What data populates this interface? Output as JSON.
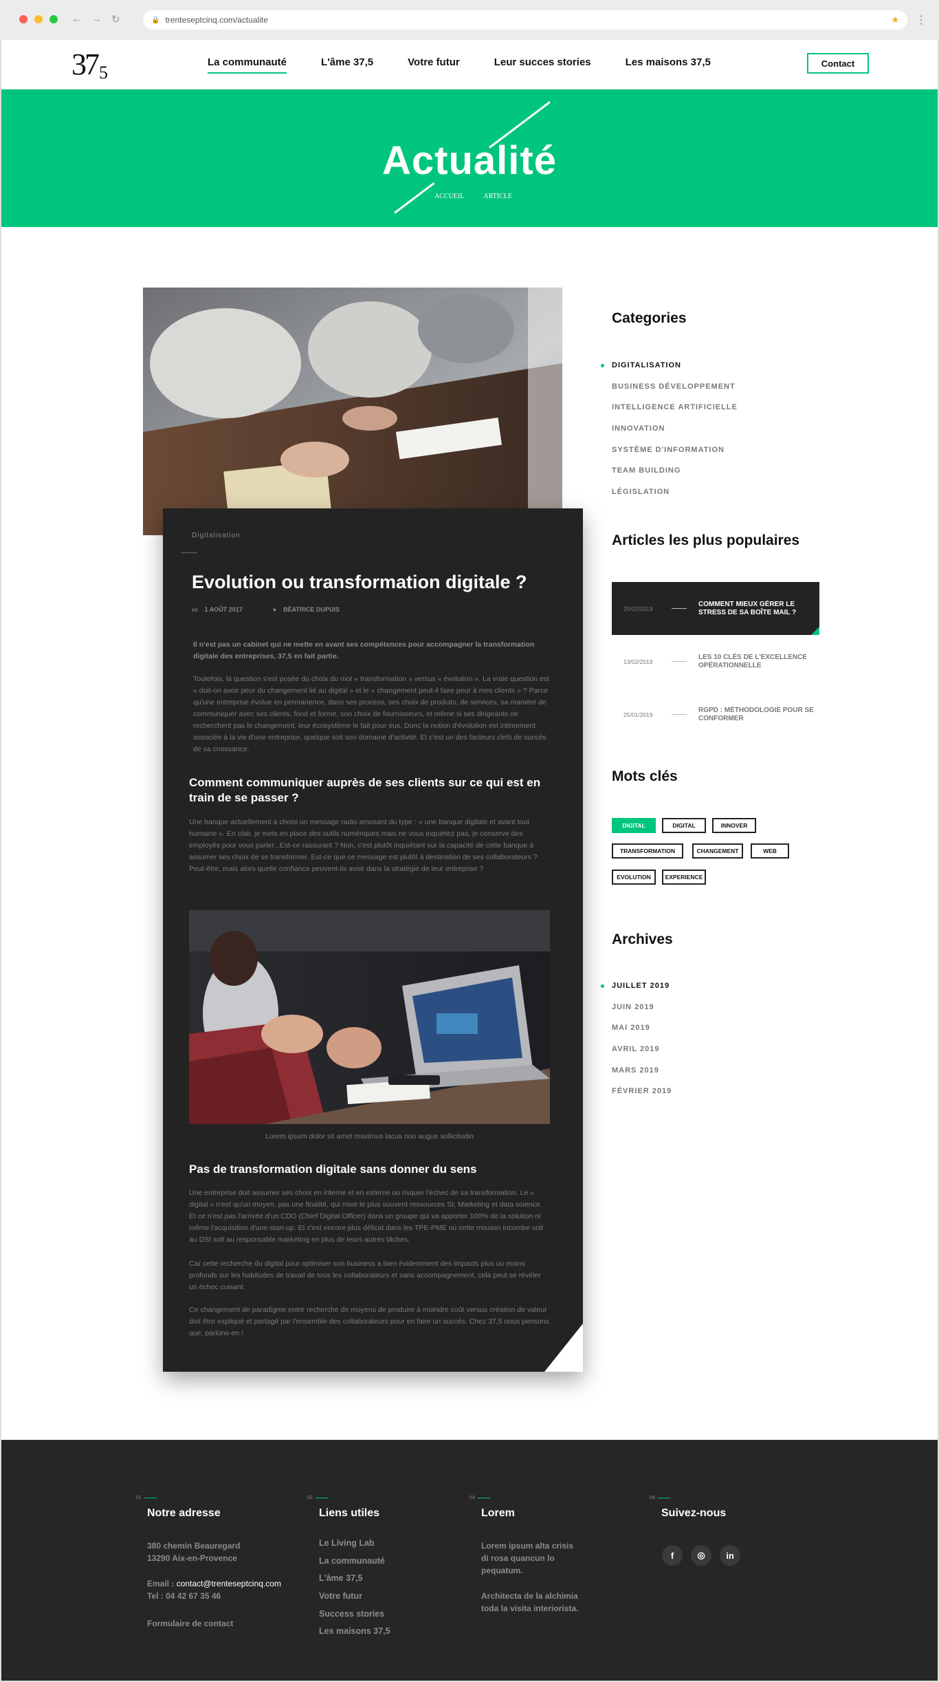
{
  "browser": {
    "url": "trenteseptcinq.com/actualite"
  },
  "header": {
    "logo": "37",
    "logo_sub": "5",
    "nav": [
      {
        "label": "La communauté"
      },
      {
        "label": "L'âme 37,5"
      },
      {
        "label": "Votre futur"
      },
      {
        "label": "Leur succes stories"
      },
      {
        "label": "Les maisons 37,5"
      }
    ],
    "contact": "Contact"
  },
  "hero": {
    "title": "Actualité",
    "crumbs": [
      "ACCUEIL",
      "ARTICLE"
    ]
  },
  "article": {
    "category": "Digitalisation",
    "title": "Evolution ou transformation digitale ?",
    "date": "1 AOÛT 2017",
    "author": "BÉATRICE DUPUIS",
    "lead": "Il n'est pas un cabinet qui ne mette en avant ses compétences pour accompagner la transformation digitale des entreprises, 37,5 en fait partie.",
    "p1": "Toutefois, la question s'est posée du choix du mot « transformation » versus « évolution ». La vraie question est « doit-on avoir peur du changement lié au digital » et le « changement peut-il faire peur à mes clients » ? Parce qu'une entreprise évolue en permanence, dans ses process, ses choix de produits, de services, sa manière de communiquer avec ses clients, fond et forme, son choix de fournisseurs, et même si ses dirigeants ne recherchent pas le changement, leur écosystème le fait pour eux. Donc la notion d'évolution est intimement associée à la vie d'une entreprise, quelque soit son domaine d'activité. Et c'est un des facteurs clefs de succès de sa croissance.",
    "h3a": "Comment communiquer auprès de ses clients sur ce qui est en train de se passer ?",
    "p2": "Une banque actuellement a choisi un message radio amusant du type : « une banque digitale et avant tout humaine ». En clair, je mets en place des outils numériques mais ne vous inquiétez pas, je conserve des employés pour vous parler...Est-ce rassurant ? Non, c'est plutôt inquiétant sur la capacité de cette banque à assumer ses choix de se transformer. Est-ce que ce message est plutôt à destination de ses collaborateurs ? Peut-être, mais alors quelle confiance peuvent-ils avoir dans la stratégie de leur entreprise ?",
    "caption": "Lorem ipsum dolor sit amet maximus lacus non augue sollicitudin",
    "h3b": "Pas de transformation digitale sans donner du sens",
    "p3": "Une entreprise doit assumer ses choix en interne et en externe ou risquer l'échec de sa transformation. Le « digital » n'est qu'un moyen, pas une finalité, qui mixe le plus souvent ressources SI, Marketing et data science. Et ce n'est pas l'arrivée d'un CDO (Chief Digital Officer) dans un groupe qui va apporter 100% de la solution ni même l'acquisition d'une start-up. Et c'est encore plus délicat dans les TPE-PME où cette mission incombe soit au DSI soit au responsable marketing en plus de leurs autres tâches.",
    "p4": "Car cette recherche du digital pour optimiser son business a bien évidemment des impacts plus ou moins profonds sur les habitudes de travail de tous les collaborateurs et sans accompagnement, cela peut se révéler un échec cuisant.",
    "p5": "Ce changement de paradigme entre recherche de moyens de produire à moindre coût versus création de valeur doit être expliqué et partagé par l'ensemble des collaborateurs pour en faire un succès. Chez 37,5 nous pensons que, parlons-en !"
  },
  "sidebar": {
    "categories_title": "Categories",
    "categories": [
      "DIGITALISATION",
      "BUSINESS DÉVELOPPEMENT",
      "INTELLIGENCE ARTIFICIELLE",
      "INNOVATION",
      "SYSTÈME D'INFORMATION",
      "TEAM BUILDING",
      "LÉGISLATION"
    ],
    "popular_title": "Articles les plus populaires",
    "popular": [
      {
        "date": "25/02/2019",
        "title": "COMMENT MIEUX GÉRER LE STRESS DE SA BOÎTE MAIL ?"
      },
      {
        "date": "13/02/2019",
        "title": "LES 10 CLÉS DE L'EXCELLENCE OPÉRATIONNELLE"
      },
      {
        "date": "25/01/2019",
        "title": "RGPD : MÉTHODOLOGIE POUR SE CONFORMER"
      }
    ],
    "tags_title": "Mots clés",
    "tags": [
      "DIGITAL",
      "DIGITAL",
      "INNOVER",
      "TRANSFORMATION",
      "CHANGEMENT",
      "WEB",
      "EVOLUTION",
      "EXPERIENCE"
    ],
    "archives_title": "Archives",
    "archives": [
      "JUILLET 2019",
      "JUIN 2019",
      "MAI 2019",
      "AVRIL 2019",
      "MARS 2019",
      "FÉVRIER 2019"
    ]
  },
  "footer": {
    "cols": [
      {
        "num": "01",
        "title": "Notre adresse"
      },
      {
        "num": "02",
        "title": "Liens utiles"
      },
      {
        "num": "03",
        "title": "Lorem"
      },
      {
        "num": "04",
        "title": "Suivez-nous"
      }
    ],
    "address1": "380 chemin Beauregard",
    "address2": "13290 Aix-en-Provence",
    "email_label": "Email : ",
    "email": "contact@trenteseptcinq.com",
    "tel": "Tel : 04 42 67 35 46",
    "form_link": "Formulaire de contact",
    "links": [
      "Le Living Lab",
      "La communauté",
      "L'âme 37,5",
      "Votre futur",
      "Success stories",
      "Les maisons 37,5"
    ],
    "lorem1": [
      "Lorem ipsum alta crisis",
      "di rosa quancun lo",
      "pequatum."
    ],
    "lorem2": [
      "Architecta de la alchimia",
      "toda la visita interiorista."
    ],
    "social": [
      "f",
      "◎",
      "in"
    ]
  },
  "colors": {
    "accent": "#00c57c",
    "dark": "#232323"
  }
}
